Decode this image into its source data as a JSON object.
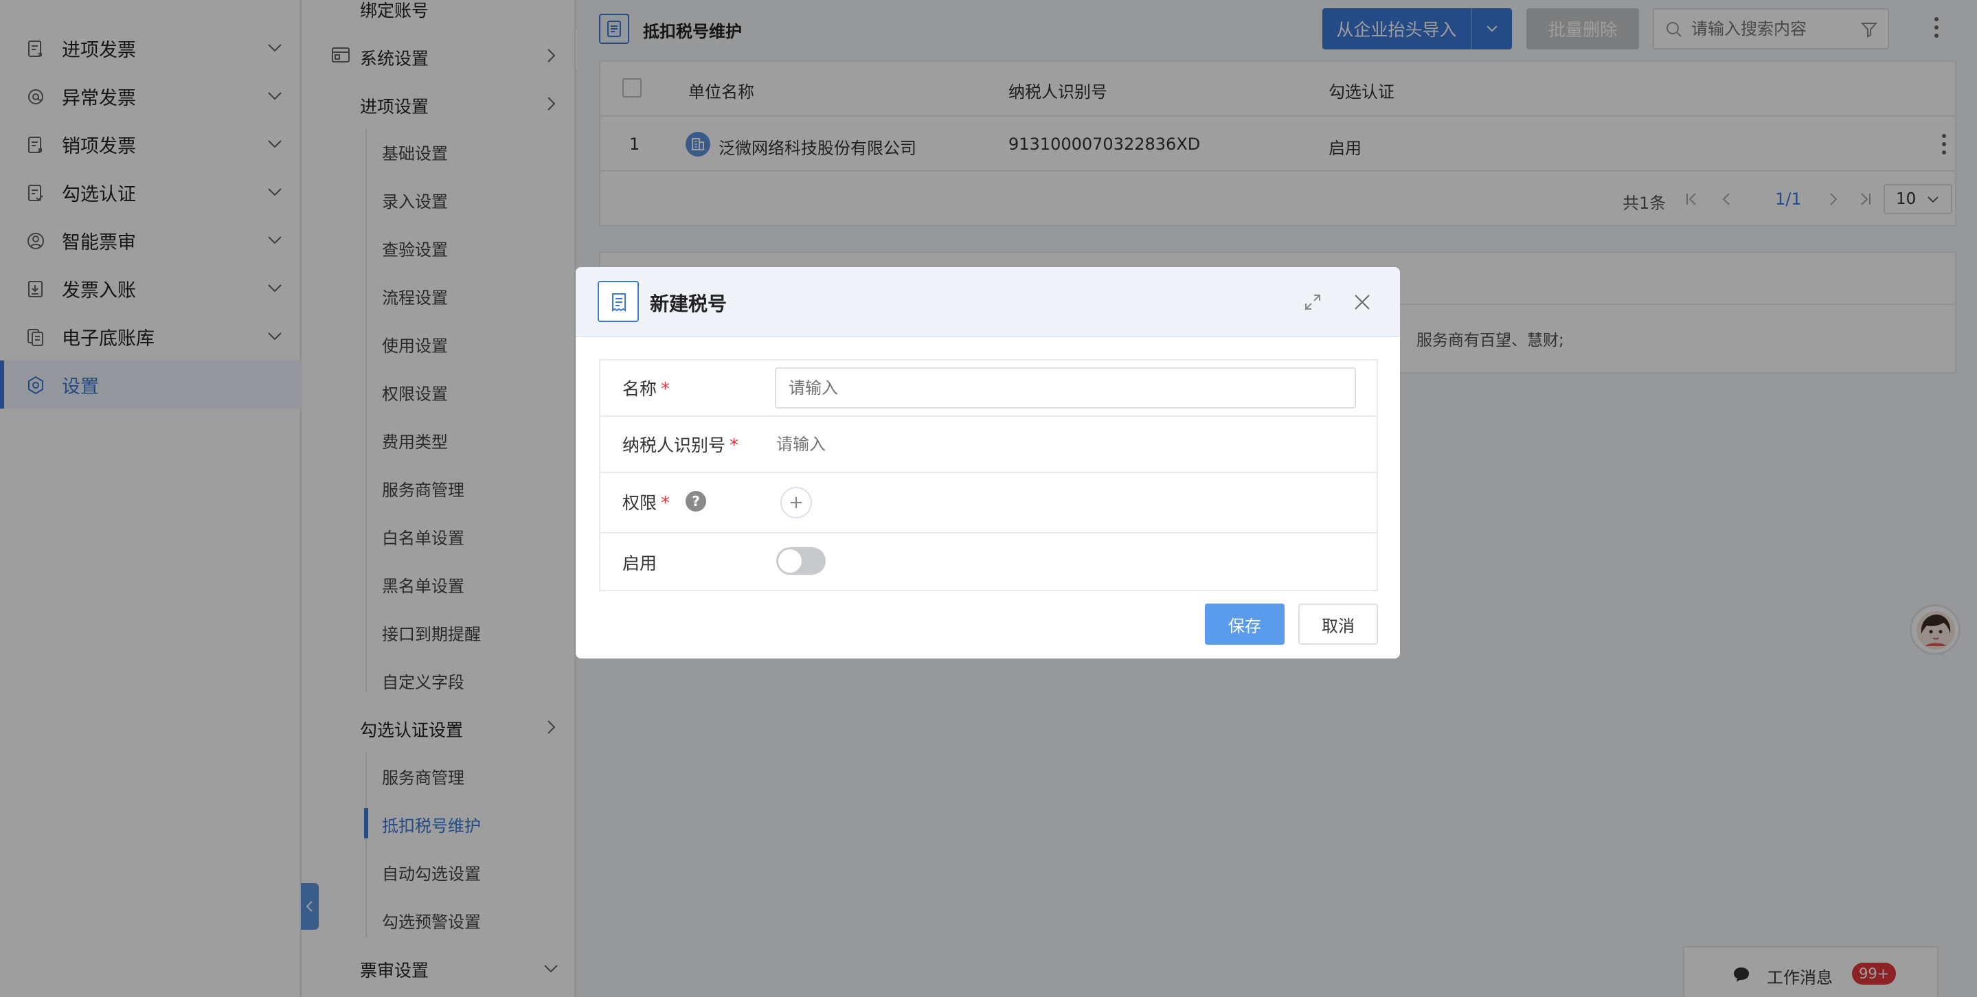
{
  "left_nav": {
    "items": [
      {
        "label": "进项发票",
        "icon": "invoice-in-icon"
      },
      {
        "label": "异常发票",
        "icon": "at-sign-icon"
      },
      {
        "label": "销项发票",
        "icon": "invoice-out-icon"
      },
      {
        "label": "勾选认证",
        "icon": "check-cert-icon"
      },
      {
        "label": "智能票审",
        "icon": "smart-review-icon"
      },
      {
        "label": "发票入账",
        "icon": "invoice-book-icon"
      },
      {
        "label": "电子底账库",
        "icon": "ledger-icon"
      },
      {
        "label": "设置",
        "icon": "settings-icon"
      }
    ]
  },
  "sub_nav": {
    "top_partial": "绑定账号",
    "system_settings": "系统设置",
    "input_settings": "进项设置",
    "input_items": [
      "基础设置",
      "录入设置",
      "查验设置",
      "流程设置",
      "使用设置",
      "权限设置",
      "费用类型",
      "服务商管理",
      "白名单设置",
      "黑名单设置",
      "接口到期提醒",
      "自定义字段"
    ],
    "check_settings": "勾选认证设置",
    "check_items": [
      "服务商管理",
      "抵扣税号维护",
      "自动勾选设置",
      "勾选预警设置"
    ],
    "review_settings": "票审设置"
  },
  "page": {
    "title": "抵扣税号维护",
    "import_button": "从企业抬头导入",
    "batch_delete_button": "批量删除",
    "search_placeholder": "请输入搜索内容"
  },
  "table": {
    "columns": [
      "单位名称",
      "纳税人识别号",
      "勾选认证"
    ],
    "rows": [
      {
        "index": "1",
        "name": "泛微网络科技股份有限公司",
        "tax_id": "9131000070322836XD",
        "status": "启用"
      }
    ]
  },
  "pagination": {
    "total": "共1条",
    "page": "1/1",
    "page_size": "10"
  },
  "info_card": {
    "text": "服务商有百望、慧财;"
  },
  "modal": {
    "title": "新建税号",
    "fields": {
      "name_label": "名称",
      "name_placeholder": "请输入",
      "tax_label": "纳税人识别号",
      "tax_placeholder": "请输入",
      "perm_label": "权限",
      "enable_label": "启用"
    },
    "required_mark": "*",
    "help_mark": "?",
    "add_mark": "+",
    "save": "保存",
    "cancel": "取消"
  },
  "messages": {
    "label": "工作消息",
    "badge": "99+"
  },
  "colors": {
    "primary": "#3b79d8",
    "required": "#e0393e",
    "badge": "#e0393e"
  }
}
